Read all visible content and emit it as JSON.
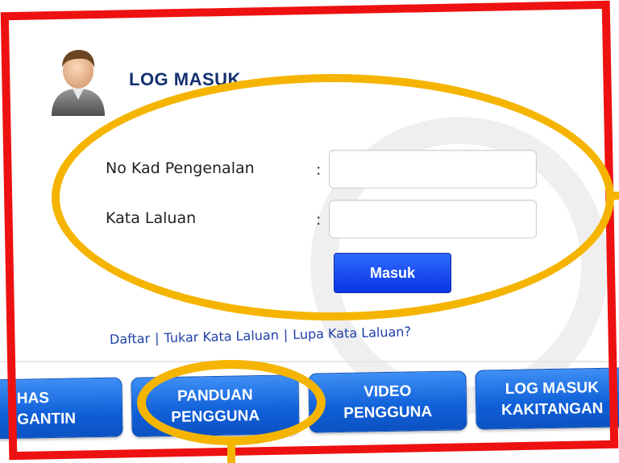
{
  "login": {
    "title": "LOG MASUK",
    "id_label": "No Kad Pengenalan",
    "password_label": "Kata Laluan",
    "colon": ":",
    "id_value": "",
    "password_value": "",
    "submit_label": "Masuk"
  },
  "links": {
    "register": "Daftar",
    "separator": "|",
    "change_password": "Tukar Kata Laluan",
    "forgot_password": "Lupa Kata Laluan?"
  },
  "nav": {
    "btn1_line1": "HAS",
    "btn1_line2": "GANTIN",
    "btn2_line1": "PANDUAN",
    "btn2_line2": "PENGGUNA",
    "btn3_line1": "VIDEO",
    "btn3_line2": "PENGGUNA",
    "btn4_line1": "LOG MASUK",
    "btn4_line2": "KAKITANGAN"
  },
  "annotation_colors": {
    "frame": "#ee1111",
    "highlight": "#f5b400",
    "button": "#0f5fd8"
  },
  "icons": {
    "avatar": "user-avatar-icon"
  }
}
